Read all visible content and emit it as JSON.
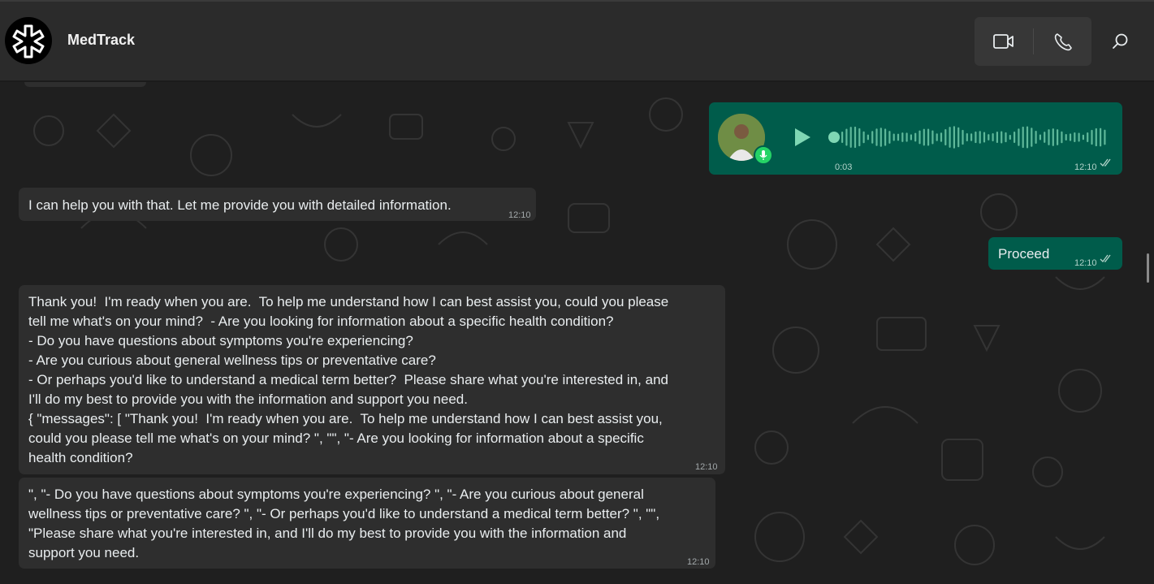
{
  "header": {
    "title": "MedTrack",
    "icons": [
      "medical-star-icon",
      "video-call-icon",
      "phone-icon",
      "search-icon"
    ]
  },
  "messages": {
    "voice": {
      "duration": "0:03",
      "time": "12:10",
      "status": "read"
    },
    "m1": {
      "text": "I can help you with that. Let me provide you with detailed information.",
      "time": "12:10"
    },
    "proceed": {
      "text": "Proceed",
      "time": "12:10",
      "status": "read"
    },
    "m2": {
      "lines": [
        "Thank you!  I'm ready when you are.  To help me understand how I can best assist you, could you please",
        "tell me what's on your mind?  - Are you looking for information about a specific health condition?",
        "- Do you have questions about symptoms you're experiencing?",
        "- Are you curious about general wellness tips or preventative care?",
        "- Or perhaps you'd like to understand a medical term better?  Please share what you're interested in, and",
        "I'll do my best to provide you with the information and support you need.",
        "{ \"messages\": [ \"Thank you!  I'm ready when you are.  To help me understand how I can best assist you,",
        "could you please tell me what's on your mind? \", \"\", \"- Are you looking for information about a specific",
        "health condition?"
      ],
      "time": "12:10"
    },
    "m3": {
      "lines": [
        "\", \"- Do you have questions about symptoms you're experiencing? \", \"- Are you curious about general",
        "wellness tips or preventative care? \", \"- Or perhaps you'd like to understand a medical term better? \", \"\",",
        "\"Please share what you're interested in, and I'll do my best to provide you with the information and",
        "support you need."
      ],
      "time": "12:10"
    }
  },
  "colors": {
    "header_bg": "#2b2b2b",
    "incoming_bubble": "#2e2e2e",
    "outgoing_bubble": "#005c4b",
    "accent_green": "#25d366"
  }
}
